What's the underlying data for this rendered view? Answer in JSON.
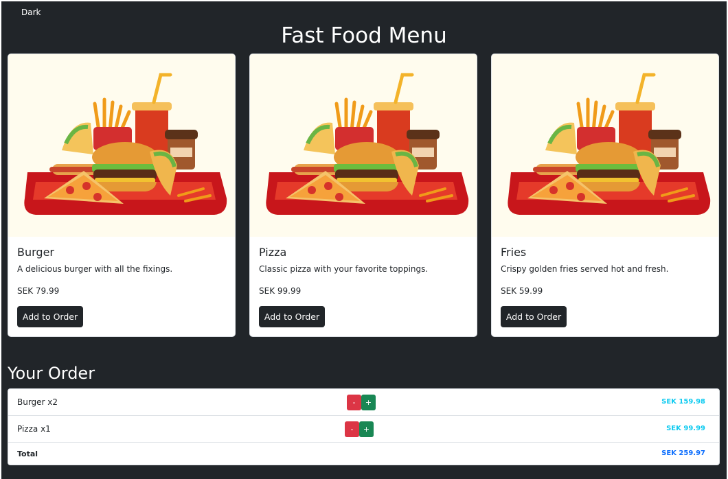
{
  "header": {
    "theme_toggle_label": "Dark",
    "title": "Fast Food Menu"
  },
  "menu": {
    "items": [
      {
        "name": "Burger",
        "description": "A delicious burger with all the fixings.",
        "price": "SEK 79.99",
        "button_label": "Add to Order"
      },
      {
        "name": "Pizza",
        "description": "Classic pizza with your favorite toppings.",
        "price": "SEK 99.99",
        "button_label": "Add to Order"
      },
      {
        "name": "Fries",
        "description": "Crispy golden fries served hot and fresh.",
        "price": "SEK 59.99",
        "button_label": "Add to Order"
      }
    ]
  },
  "order": {
    "title": "Your Order",
    "rows": [
      {
        "label": "Burger x2",
        "minus": "-",
        "plus": "+",
        "price": "SEK 159.98"
      },
      {
        "label": "Pizza x1",
        "minus": "-",
        "plus": "+",
        "price": "SEK 99.99"
      }
    ],
    "total_label": "Total",
    "total_value": "SEK 259.97"
  },
  "colors": {
    "page_bg": "#212529",
    "card_bg": "#ffffff",
    "image_bg": "#fffcee",
    "button_dark": "#212529",
    "minus_red": "#dc3545",
    "plus_green": "#198754",
    "price_cyan": "#0dcaf0",
    "total_blue": "#0d6efd"
  },
  "icons": {
    "food_image": "fast-food-tray-illustration"
  }
}
